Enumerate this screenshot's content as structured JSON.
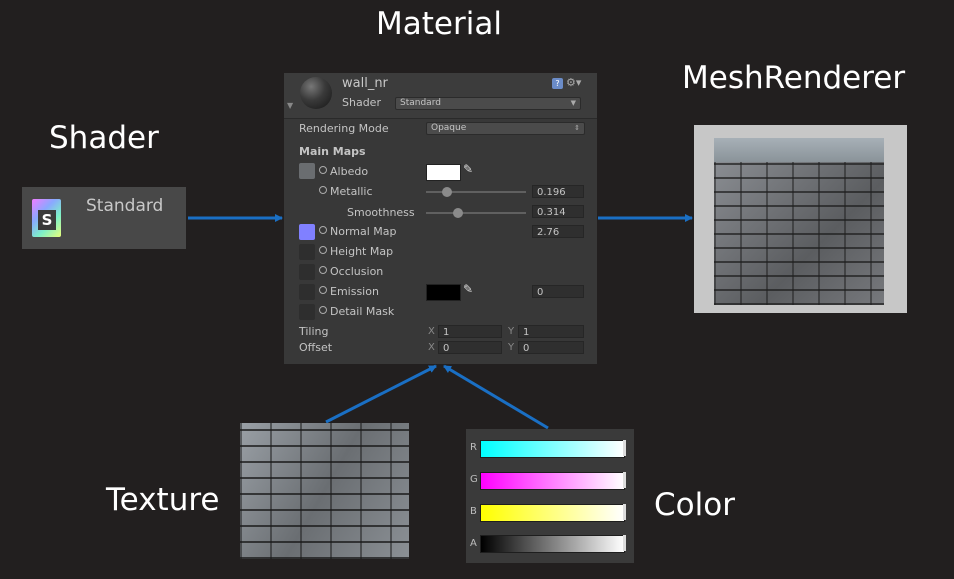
{
  "labels": {
    "material": "Material",
    "shader": "Shader",
    "mesh_renderer": "MeshRenderer",
    "texture": "Texture",
    "color": "Color"
  },
  "shader_asset": {
    "icon_letter": "S",
    "name": "Standard",
    "icon": "shader-icon"
  },
  "inspector": {
    "material_name": "wall_nr",
    "shader_label": "Shader",
    "shader_value": "Standard",
    "rendering_mode_label": "Rendering Mode",
    "rendering_mode_value": "Opaque",
    "main_maps_label": "Main Maps",
    "albedo_label": "Albedo",
    "metallic_label": "Metallic",
    "metallic_value": "0.196",
    "smoothness_label": "Smoothness",
    "smoothness_value": "0.314",
    "normal_map_label": "Normal Map",
    "normal_map_value": "2.76",
    "height_map_label": "Height Map",
    "occlusion_label": "Occlusion",
    "emission_label": "Emission",
    "emission_value": "0",
    "detail_mask_label": "Detail Mask",
    "tiling_label": "Tiling",
    "offset_label": "Offset",
    "x_letter": "X",
    "y_letter": "Y",
    "tiling_x": "1",
    "tiling_y": "1",
    "offset_x": "0",
    "offset_y": "0",
    "metallic_fraction": 0.196,
    "smoothness_fraction": 0.314,
    "albedo_color": "#ffffff",
    "emission_color": "#000000",
    "normal_map_color": "#8080ff"
  },
  "color_picker": {
    "channels": [
      {
        "letter": "R",
        "gradient_from": "#00ffff",
        "gradient_to": "#ffffff"
      },
      {
        "letter": "G",
        "gradient_from": "#ff00ff",
        "gradient_to": "#ffffff"
      },
      {
        "letter": "B",
        "gradient_from": "#ffff00",
        "gradient_to": "#ffffff"
      },
      {
        "letter": "A",
        "gradient_from": "#000000",
        "gradient_to": "#ffffff"
      }
    ]
  },
  "colors": {
    "background": "#221f1f",
    "arrow": "#1a6fc4"
  }
}
